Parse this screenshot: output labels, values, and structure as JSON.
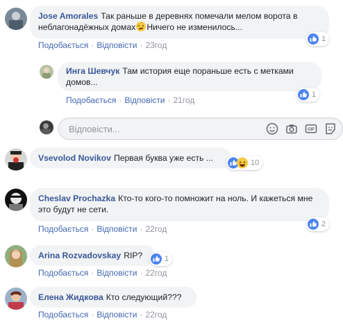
{
  "actions": {
    "like": "Подобається",
    "reply": "Відповісти"
  },
  "comments": [
    {
      "author": "Jose Amorales",
      "text": "Так раньше в деревнях помечали мелом ворота в неблагонадёжных домах",
      "text_after_emoji": "Ничего не изменилось...",
      "emoji": "confused-face-emoji",
      "time": "23год",
      "reactions": {
        "count": "1"
      }
    },
    {
      "author": "Инга Шевчук",
      "text": "Там история еще пораньше есть с метками домов...",
      "time": "21год",
      "reactions": {
        "count": "1"
      }
    },
    {
      "author": "Vsevolod Novikov",
      "text": "Первая буква уже есть ...",
      "reactions": {
        "count": "10"
      }
    },
    {
      "author": "Cheslav Prochazka",
      "text": "Кто-то кого-то помножит на ноль. И кажеться мне это будут не сети.",
      "time": "22год",
      "reactions": {
        "count": "2"
      }
    },
    {
      "author": "Arina Rozvadovskay",
      "text": "RIP?",
      "time": "22год",
      "reactions": {
        "count": "1"
      }
    },
    {
      "author": "Елена Жидкова",
      "text": "Кто следующий???",
      "time": "22год"
    }
  ],
  "reply_box": {
    "placeholder": "Відповісти..."
  },
  "icons": {
    "emoji": "smiley-icon",
    "camera": "camera-icon",
    "gif": "gif-icon",
    "sticker": "sticker-icon",
    "like": "like-icon",
    "haha": "haha-icon"
  },
  "gif_label": "GIF",
  "colors": {
    "link": "#385898",
    "action": "#4267b2",
    "meta": "#90949c",
    "bubble": "#f2f3f5",
    "like": "#4c84f0"
  }
}
